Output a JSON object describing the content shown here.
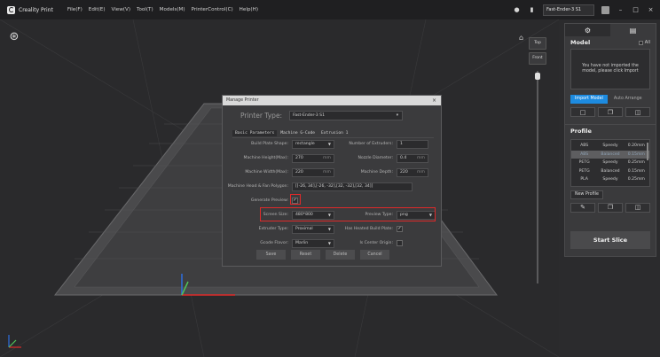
{
  "app": {
    "name": "Creality Print"
  },
  "menu": [
    "File(F)",
    "Edit(E)",
    "View(V)",
    "Tool(T)",
    "Models(M)",
    "PrinterControl(C)",
    "Help(H)"
  ],
  "titlebar": {
    "printer": "Fast-Ender-3 S1",
    "window_controls": [
      "minimize-icon",
      "maximize-icon",
      "close-icon"
    ]
  },
  "viewport": {
    "view_cube": {
      "top": "Top",
      "front": "Front"
    }
  },
  "right_panel": {
    "model_title": "Model",
    "all_label": "All",
    "empty_message": "You have not imported the model, please click Import",
    "import_button": "Import Model",
    "arrange_button": "Auto Arrange",
    "profile_title": "Profile",
    "profiles": [
      {
        "material": "ABS",
        "quality": "Speedy",
        "layer": "0.20mm",
        "selected": false
      },
      {
        "material": "ABS",
        "quality": "Balanced",
        "layer": "0.15mm",
        "selected": true
      },
      {
        "material": "PETG",
        "quality": "Speedy",
        "layer": "0.25mm",
        "selected": false
      },
      {
        "material": "PETG",
        "quality": "Balanced",
        "layer": "0.15mm",
        "selected": false
      },
      {
        "material": "PLA",
        "quality": "Speedy",
        "layer": "0.25mm",
        "selected": false
      }
    ],
    "new_profile": "New Profile",
    "start_slice": "Start Slice"
  },
  "dialog": {
    "title": "Manage Printer",
    "printer_type_label": "Printer Type:",
    "printer_type_value": "Fast-Ender-3 S1",
    "tabs": [
      "Basic Parameters",
      "Machine G-Code",
      "Extrusion 1"
    ],
    "build_plate_shape": {
      "label": "Build Plate Shape:",
      "value": "rectangle"
    },
    "num_extruders": {
      "label": "Number of Extruders:",
      "value": "1"
    },
    "machine_height": {
      "label": "Machine Height(Max):",
      "value": "270",
      "unit": "mm"
    },
    "nozzle_diameter": {
      "label": "Nozzle Diameter:",
      "value": "0.4",
      "unit": "mm"
    },
    "machine_width": {
      "label": "Machine Width(Max):",
      "value": "220",
      "unit": "mm"
    },
    "machine_depth": {
      "label": "Machine Depth:",
      "value": "220",
      "unit": "mm"
    },
    "head_polygon": {
      "label": "Machine Head & Fan Polygon:",
      "value": "[[-26, 34],[-26, -32],[32, -32],[32, 34]]"
    },
    "generate_preview": {
      "label": "Generate Preview:",
      "checked": true
    },
    "screen_size": {
      "label": "Screen Size:",
      "value": "480*800"
    },
    "preview_type": {
      "label": "Preview Type:",
      "value": "png"
    },
    "extruder_type": {
      "label": "Extruder Type:",
      "value": "Proximal"
    },
    "heated_bed": {
      "label": "Has Heated Build Plate:",
      "checked": true
    },
    "gcode_flavor": {
      "label": "Gcode Flavor:",
      "value": "Marlin"
    },
    "center_origin": {
      "label": "Is Center Origin:",
      "checked": false
    },
    "buttons": {
      "save": "Save",
      "reset": "Reset",
      "delete": "Delete",
      "cancel": "Cancel"
    }
  },
  "colors": {
    "accent_blue": "#1d8be0",
    "highlight_red": "#e02a2a",
    "plate": "#4a4a4c"
  }
}
